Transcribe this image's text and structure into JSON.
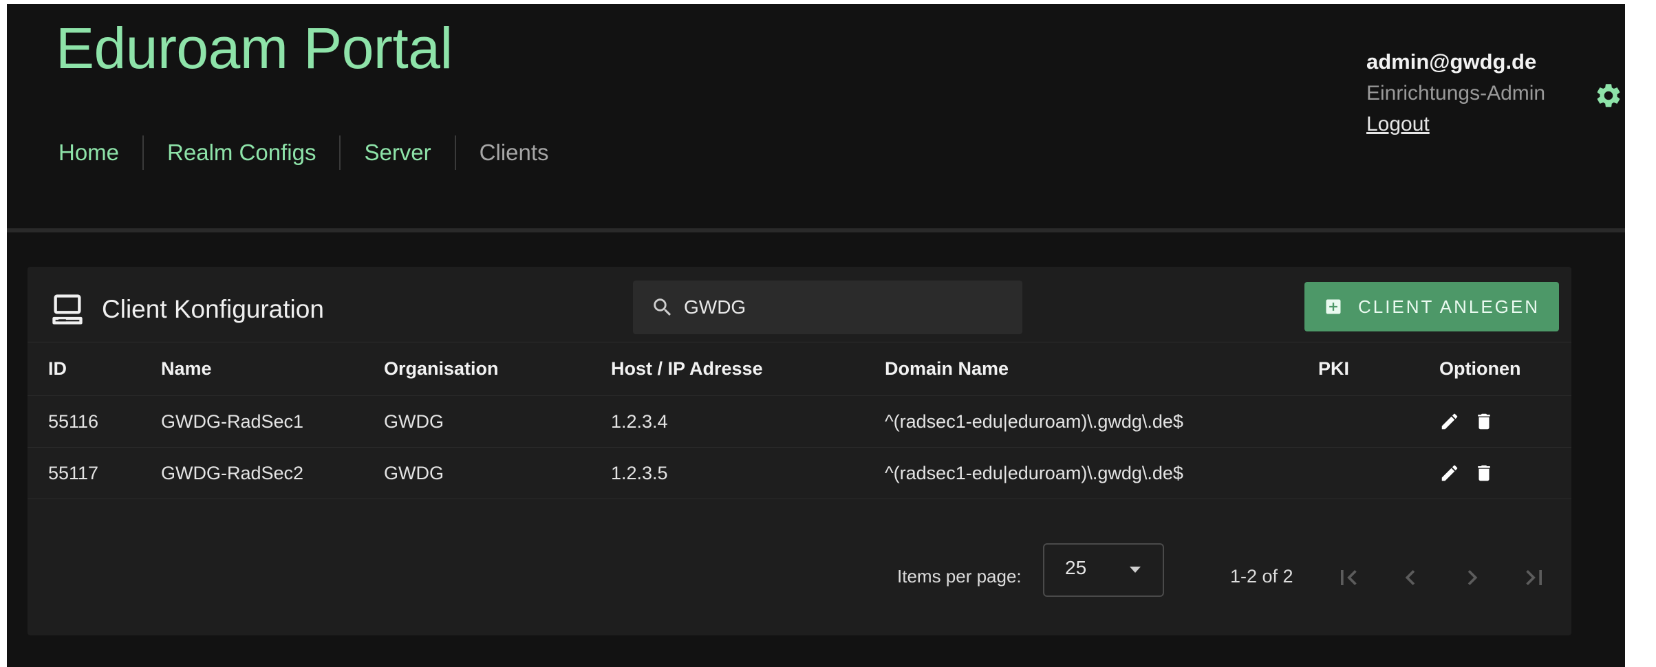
{
  "app": {
    "title": "Eduroam Portal"
  },
  "nav": {
    "items": [
      {
        "label": "Home",
        "active": false
      },
      {
        "label": "Realm Configs",
        "active": false
      },
      {
        "label": "Server",
        "active": false
      },
      {
        "label": "Clients",
        "active": true
      }
    ]
  },
  "user": {
    "email": "admin@gwdg.de",
    "role": "Einrichtungs-Admin",
    "logout_label": "Logout"
  },
  "icons": {
    "settings": "gear-icon",
    "card": "computer-icon",
    "search": "search-icon",
    "add": "add-box-icon",
    "edit": "pencil-icon",
    "delete": "trash-icon",
    "first_page": "first-page-icon",
    "prev_page": "chevron-left-icon",
    "next_page": "chevron-right-icon",
    "last_page": "last-page-icon"
  },
  "colors": {
    "accent": "#8ee3a9",
    "button": "#4d9868",
    "background": "#121212",
    "card": "#1e1e1e"
  },
  "card": {
    "title": "Client Konfiguration",
    "search_value": "GWDG",
    "add_button_label": "CLIENT ANLEGEN"
  },
  "table": {
    "columns": {
      "id": "ID",
      "name": "Name",
      "org": "Organisation",
      "host": "Host / IP Adresse",
      "domain": "Domain Name",
      "pki": "PKI",
      "options": "Optionen"
    },
    "rows": [
      {
        "id": "55116",
        "name": "GWDG-RadSec1",
        "org": "GWDG",
        "host": "1.2.3.4",
        "domain": "^(radsec1-edu|eduroam)\\.gwdg\\.de$",
        "pki": ""
      },
      {
        "id": "55117",
        "name": "GWDG-RadSec2",
        "org": "GWDG",
        "host": "1.2.3.5",
        "domain": "^(radsec1-edu|eduroam)\\.gwdg\\.de$",
        "pki": ""
      }
    ]
  },
  "paginator": {
    "items_per_page_label": "Items per page:",
    "items_per_page_value": "25",
    "range_label": "1-2 of 2"
  }
}
